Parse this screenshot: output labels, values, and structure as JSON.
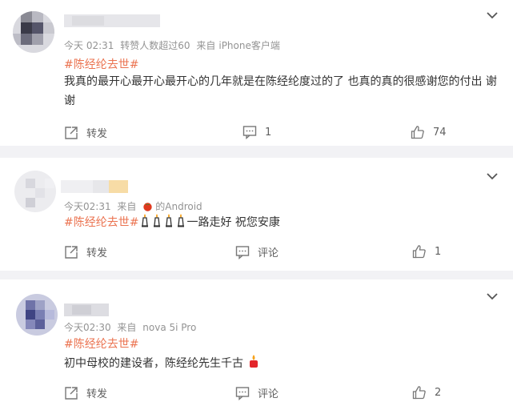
{
  "comments": [
    {
      "time": "今天 02:31",
      "extra": "转赞人数超过60",
      "source_prefix": "来自",
      "source": "iPhone客户端",
      "hashtag": "#陈经纶去世#",
      "text": "我真的最开心最开心最开心的几年就是在陈经纶度过的了 也真的真的很感谢您的付出 谢谢",
      "actions": {
        "repost": "转发",
        "comment": "1",
        "like": "74"
      }
    },
    {
      "time": "今天02:31",
      "source_prefix": "来自",
      "source": "的Android",
      "source_icon": "tomato-icon",
      "hashtag": "#陈经纶去世#",
      "emoji": "candle-icon",
      "emoji_count": 4,
      "text": "一路走好 祝您安康",
      "actions": {
        "repost": "转发",
        "comment": "评论",
        "like": "1"
      }
    },
    {
      "time": "今天02:30",
      "source_prefix": "来自",
      "source": "nova 5i Pro",
      "hashtag": "#陈经纶去世#",
      "text": "初中母校的建设者，陈经纶先生千古",
      "emoji": "candle-icon",
      "actions": {
        "repost": "转发",
        "comment": "评论",
        "like": "2"
      }
    }
  ],
  "colors": {
    "hashtag": "#eb7350",
    "meta": "#939393",
    "text": "#333333",
    "background": "#f2f2f5"
  }
}
